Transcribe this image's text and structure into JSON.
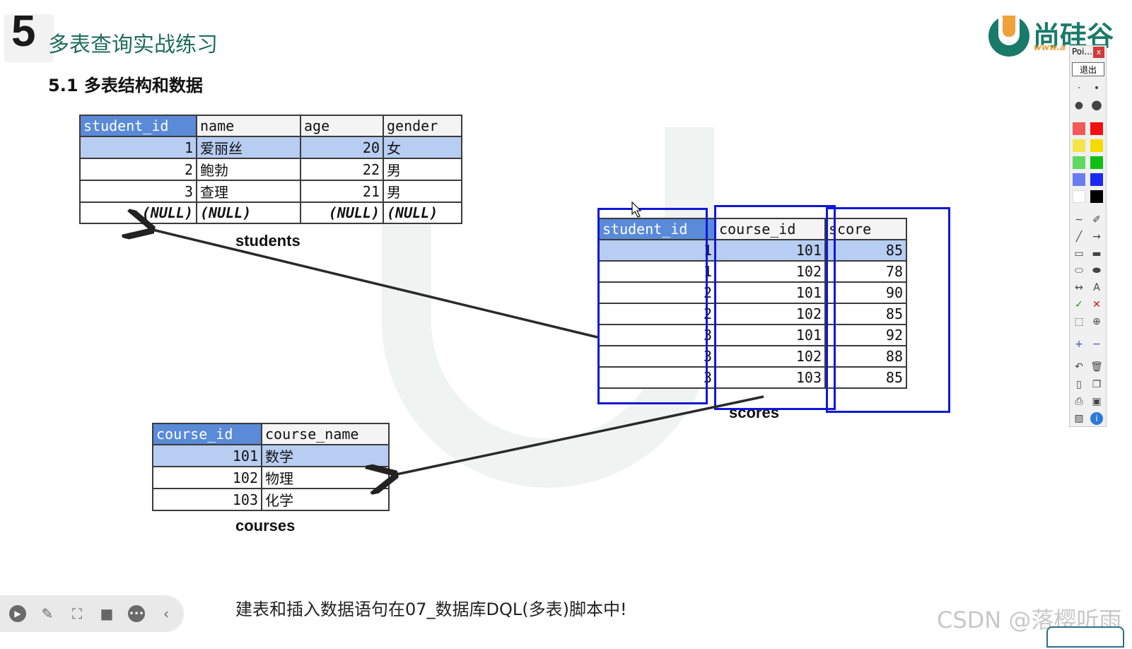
{
  "header": {
    "slide_number": "5",
    "title": "多表查询实战练习",
    "subtitle": "5.1 多表结构和数据"
  },
  "logo": {
    "text": "尚硅谷",
    "url": "www.a"
  },
  "students": {
    "caption": "students",
    "columns": [
      "student_id",
      "name",
      "age",
      "gender"
    ],
    "rows": [
      [
        "1",
        "爱丽丝",
        "20",
        "女"
      ],
      [
        "2",
        "鲍勃",
        "22",
        "男"
      ],
      [
        "3",
        "查理",
        "21",
        "男"
      ],
      [
        "(NULL)",
        "(NULL)",
        "(NULL)",
        "(NULL)"
      ]
    ]
  },
  "scores": {
    "caption": "scores",
    "columns": [
      "student_id",
      "course_id",
      "score"
    ],
    "rows": [
      [
        "1",
        "101",
        "85"
      ],
      [
        "1",
        "102",
        "78"
      ],
      [
        "2",
        "101",
        "90"
      ],
      [
        "2",
        "102",
        "85"
      ],
      [
        "3",
        "101",
        "92"
      ],
      [
        "3",
        "102",
        "88"
      ],
      [
        "3",
        "103",
        "85"
      ]
    ]
  },
  "courses": {
    "caption": "courses",
    "columns": [
      "course_id",
      "course_name"
    ],
    "rows": [
      [
        "101",
        "数学"
      ],
      [
        "102",
        "物理"
      ],
      [
        "103",
        "化学"
      ]
    ]
  },
  "footer_note": "建表和插入数据语句在07_数据库DQL(多表)脚本中!",
  "watermark": "CSDN @落樱听雨",
  "toolbar": {
    "title": "Poi...",
    "close": "x",
    "exit": "退出",
    "colors": [
      "#f25a5a",
      "#f21010",
      "#f5e54a",
      "#f5dc00",
      "#5fd85f",
      "#10c010",
      "#6a7cf0",
      "#1a2af0",
      "#ffffff",
      "#000000"
    ],
    "icons": [
      "small-dot-icon",
      "medium-dot-icon",
      "large-dot-icon",
      "xlarge-dot-icon",
      "freehand-icon",
      "eraser-icon",
      "line-icon",
      "arrow-icon",
      "rectangle-icon",
      "filled-rectangle-icon",
      "ellipse-icon",
      "filled-ellipse-icon",
      "double-arrow-icon",
      "text-icon",
      "check-icon",
      "cross-icon",
      "crop-icon",
      "zoom-icon",
      "plus-icon",
      "minus-icon",
      "undo-icon",
      "delete-icon",
      "new-page-icon",
      "copy-icon",
      "print-icon",
      "save-icon",
      "picture-icon",
      "info-icon"
    ]
  },
  "controls": [
    "play-icon",
    "pen-icon",
    "screenshot-icon",
    "camera-icon",
    "more-icon",
    "collapse-icon"
  ]
}
